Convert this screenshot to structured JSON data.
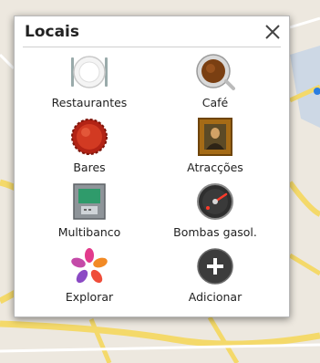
{
  "dialog": {
    "title": "Locais",
    "close_icon": "close-icon"
  },
  "places": [
    {
      "label": "Restaurantes",
      "icon": "plate-icon"
    },
    {
      "label": "Café",
      "icon": "coffee-cup-icon"
    },
    {
      "label": "Bares",
      "icon": "bottle-cap-icon"
    },
    {
      "label": "Atracções",
      "icon": "mona-lisa-painting-icon"
    },
    {
      "label": "Multibanco",
      "icon": "atm-icon"
    },
    {
      "label": "Bombas gasol.",
      "icon": "fuel-gauge-icon"
    },
    {
      "label": "Explorar",
      "icon": "flower-explore-icon"
    },
    {
      "label": "Adicionar",
      "icon": "add-icon"
    }
  ],
  "colors": {
    "map_land": "#ede8df",
    "map_road": "#f5dc6e",
    "map_water": "#a9c5ec",
    "dialog_bg": "#ffffff"
  }
}
